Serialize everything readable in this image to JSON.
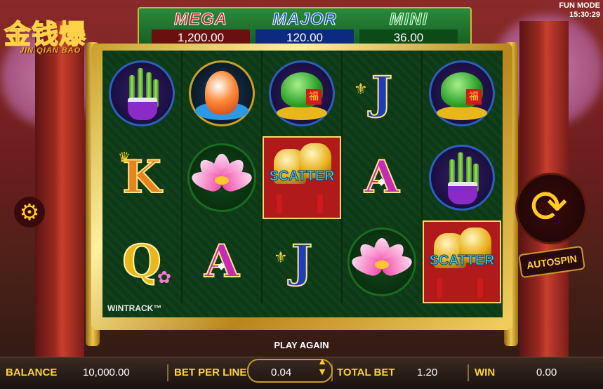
{
  "game": {
    "logo_cn": "金钱爆",
    "logo_en": "JIN QIAN BAO",
    "mode": "FUN MODE",
    "time": "15:30:29"
  },
  "jackpots": [
    {
      "label": "MEGA",
      "value": "1,200.00"
    },
    {
      "label": "MAJOR",
      "value": "120.00"
    },
    {
      "label": "MINI",
      "value": "36.00"
    }
  ],
  "reels": [
    [
      "bamboo-symbol",
      "k-symbol",
      "q-symbol"
    ],
    [
      "koi-symbol",
      "lotus-symbol",
      "a-symbol"
    ],
    [
      "frog-symbol",
      "scatter-symbol",
      "j-symbol"
    ],
    [
      "j-symbol",
      "a-symbol",
      "lotus-symbol"
    ],
    [
      "frog-symbol",
      "bamboo-symbol",
      "scatter-symbol"
    ]
  ],
  "symbols": {
    "k": "K",
    "q": "Q",
    "a": "A",
    "j": "J",
    "scatter": "SCATTER",
    "fu": "福"
  },
  "wintrack": "WINTRACK™",
  "autospin": "AUTOSPIN",
  "play_again": "PLAY AGAIN",
  "bottom": {
    "balance_label": "BALANCE",
    "balance_value": "10,000.00",
    "bet_per_line_label": "BET PER LINE",
    "bet_per_line_value": "0.04",
    "total_bet_label": "TOTAL BET",
    "total_bet_value": "1.20",
    "win_label": "WIN",
    "win_value": "0.00"
  }
}
